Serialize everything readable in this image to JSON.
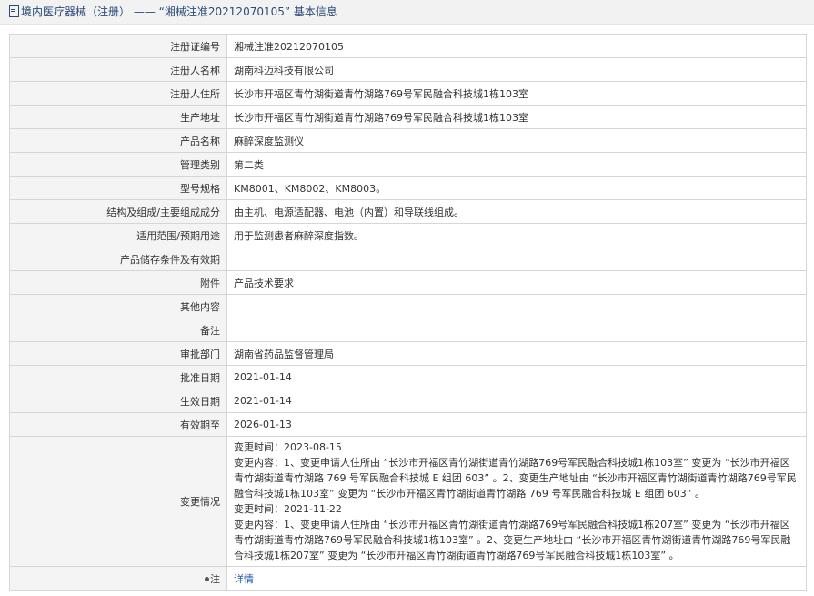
{
  "header": {
    "prefix": "境内医疗器械（注册）",
    "separator": "——",
    "title": "“湘械注准20212070105” 基本信息"
  },
  "rows": [
    {
      "label": "注册证编号",
      "value": "湘械注准20212070105"
    },
    {
      "label": "注册人名称",
      "value": "湖南科迈科技有限公司"
    },
    {
      "label": "注册人住所",
      "value": "长沙市开福区青竹湖街道青竹湖路769号军民融合科技城1栋103室"
    },
    {
      "label": "生产地址",
      "value": "长沙市开福区青竹湖街道青竹湖路769号军民融合科技城1栋103室"
    },
    {
      "label": "产品名称",
      "value": "麻醉深度监测仪"
    },
    {
      "label": "管理类别",
      "value": "第二类"
    },
    {
      "label": "型号规格",
      "value": "KM8001、KM8002、KM8003。"
    },
    {
      "label": "结构及组成/主要组成成分",
      "value": "由主机、电源适配器、电池（内置）和导联线组成。"
    },
    {
      "label": "适用范围/预期用途",
      "value": "用于监测患者麻醉深度指数。"
    },
    {
      "label": "产品储存条件及有效期",
      "value": ""
    },
    {
      "label": "附件",
      "value": "产品技术要求"
    },
    {
      "label": "其他内容",
      "value": ""
    },
    {
      "label": "备注",
      "value": ""
    },
    {
      "label": "审批部门",
      "value": "湖南省药品监督管理局"
    },
    {
      "label": "批准日期",
      "value": "2021-01-14"
    },
    {
      "label": "生效日期",
      "value": "2021-01-14"
    },
    {
      "label": "有效期至",
      "value": "2026-01-13"
    }
  ],
  "changes": {
    "label": "变更情况",
    "lines": [
      "变更时间：2023-08-15",
      "变更内容：1、变更申请人住所由 “长沙市开福区青竹湖街道青竹湖路769号军民融合科技城1栋103室” 变更为 “长沙市开福区青竹湖街道青竹湖路 769 号军民融合科技城 E 组团 603” 。2、变更生产地址由 “长沙市开福区青竹湖街道青竹湖路769号军民融合科技城1栋103室” 变更为 “长沙市开福区青竹湖街道青竹湖路 769 号军民融合科技城 E 组团 603” 。",
      "变更时间：2021-11-22",
      "变更内容：1、变更申请人住所由 “长沙市开福区青竹湖街道青竹湖路769号军民融合科技城1栋207室” 变更为 “长沙市开福区青竹湖街道青竹湖路769号军民融合科技城1栋103室” 。2、变更生产地址由 “长沙市开福区青竹湖街道青竹湖路769号军民融合科技城1栋207室” 变更为 “长沙市开福区青竹湖街道青竹湖路769号军民融合科技城1栋103室” 。"
    ]
  },
  "note": {
    "label": "注",
    "link_text": "详情"
  }
}
